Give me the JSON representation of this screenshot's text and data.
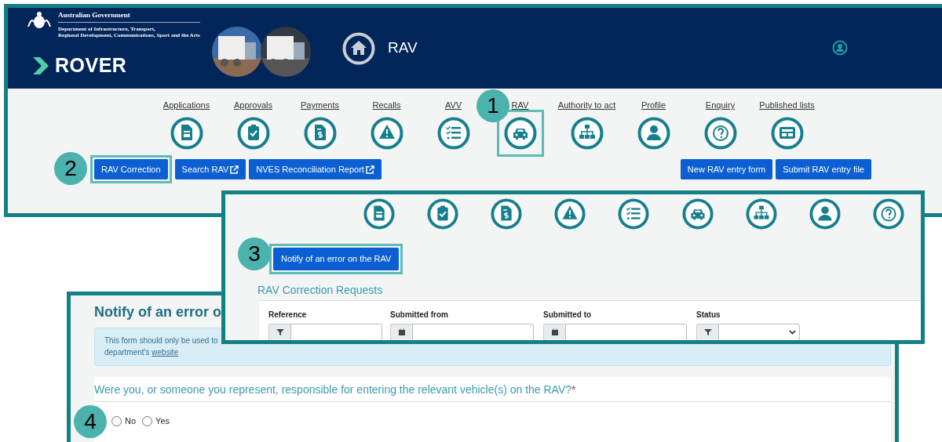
{
  "header": {
    "org": "Australian Government",
    "department_lines": [
      "Department of Infrastructure, Transport,",
      "Regional Development, Communications, Sport and the Arts"
    ],
    "app_name": "ROVER",
    "page_title": "RAV"
  },
  "nav": [
    {
      "label": "Applications",
      "selected": false
    },
    {
      "label": "Approvals",
      "selected": false
    },
    {
      "label": "Payments",
      "selected": false
    },
    {
      "label": "Recalls",
      "selected": false
    },
    {
      "label": "AVV",
      "selected": false
    },
    {
      "label": "RAV",
      "selected": true,
      "step": "1"
    },
    {
      "label": "Authority to act",
      "selected": false
    },
    {
      "label": "Profile",
      "selected": false
    },
    {
      "label": "Enquiry",
      "selected": false
    },
    {
      "label": "Published lists",
      "selected": false
    }
  ],
  "actions_left": [
    {
      "label": "RAV Correction",
      "external": false,
      "step": "2"
    },
    {
      "label": "Search RAV",
      "external": true
    },
    {
      "label": "NVES Reconciliation Report",
      "external": true
    }
  ],
  "actions_right": [
    {
      "label": "New RAV entry form"
    },
    {
      "label": "Submit RAV entry file"
    }
  ],
  "correction_page": {
    "button": {
      "label": "Notify of an error on the RAV",
      "step": "3"
    },
    "title": "RAV Correction Requests",
    "filters": [
      {
        "label": "Reference",
        "kind": "text"
      },
      {
        "label": "Submitted from",
        "kind": "date"
      },
      {
        "label": "Submitted to",
        "kind": "date"
      },
      {
        "label": "Status",
        "kind": "select"
      }
    ]
  },
  "form_page": {
    "title": "Notify of an error o",
    "notice_line_1": "This form should only be used to",
    "notice_line_2": "department's",
    "notice_link": "website",
    "question": "Were you, or someone you represent, responsible for entering the relevant vehicle(s) on the RAV?",
    "required_mark": "*",
    "options": [
      {
        "label": "No",
        "selected": false
      },
      {
        "label": "Yes",
        "selected": false
      }
    ],
    "step": "4"
  }
}
